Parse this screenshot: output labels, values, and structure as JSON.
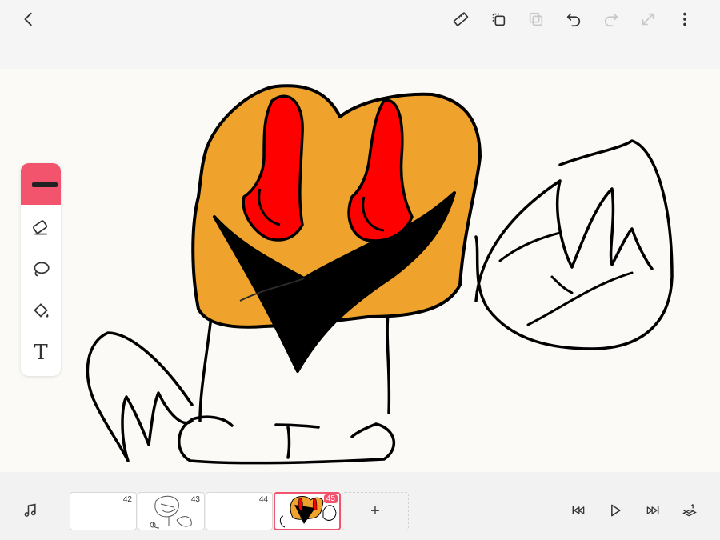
{
  "topbar": {
    "icons": [
      "back-chevron-icon",
      "ruler-icon",
      "copy-layers-icon",
      "duplicate-icon",
      "undo-icon",
      "redo-icon",
      "resize-icon",
      "more-icon"
    ]
  },
  "tools": [
    "brush-pen",
    "eraser",
    "lasso",
    "paint-bucket",
    "text"
  ],
  "tool_labels": {
    "text": "T"
  },
  "colors": {
    "accent": "#f2546e",
    "orange": "#f0a62c",
    "red": "#ff0000",
    "ink": "#000000"
  },
  "timeline": {
    "frames": [
      {
        "number": "42"
      },
      {
        "number": "43"
      },
      {
        "number": "44"
      },
      {
        "number": "45",
        "active": true
      }
    ],
    "add_label": "+"
  },
  "playback": [
    "music-icon",
    "skip-start-icon",
    "play-icon",
    "skip-end-icon",
    "onion-skin-icon"
  ]
}
